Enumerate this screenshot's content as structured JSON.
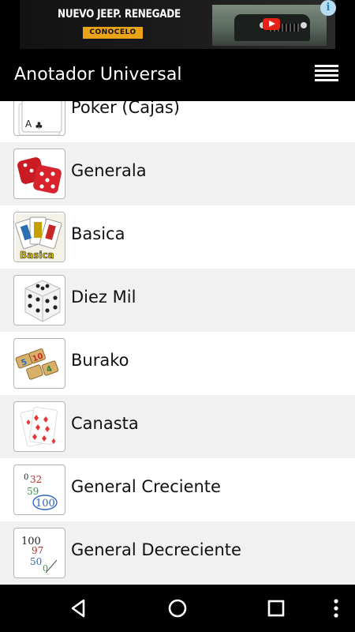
{
  "ad": {
    "headline": "NUEVO JEEP. RENEGADE",
    "cta": "CONOCELO",
    "info_icon": "info-icon"
  },
  "app": {
    "title": "Anotador Universal",
    "menu_icon": "hamburger-menu-icon"
  },
  "games": [
    {
      "label": "Poker (Cajas)",
      "icon": "poker-cards-icon"
    },
    {
      "label": "Generala",
      "icon": "red-dice-icon"
    },
    {
      "label": "Basica",
      "icon": "spanish-cards-icon",
      "icon_text": "Basica"
    },
    {
      "label": "Diez Mil",
      "icon": "white-die-icon"
    },
    {
      "label": "Burako",
      "icon": "domino-tiles-icon",
      "tile_numbers": [
        "5",
        "10",
        "4"
      ]
    },
    {
      "label": "Canasta",
      "icon": "diamond-cards-icon"
    },
    {
      "label": "General Creciente",
      "icon": "increasing-numbers-icon",
      "numbers": [
        "0",
        "32",
        "59",
        "100"
      ]
    },
    {
      "label": "General Decreciente",
      "icon": "decreasing-numbers-icon",
      "numbers": [
        "100",
        "97",
        "50",
        "0"
      ]
    }
  ],
  "navbar": {
    "back": "back-icon",
    "home": "home-icon",
    "recents": "recents-icon",
    "more": "more-vertical-icon"
  },
  "colors": {
    "bar_background": "#000000",
    "row_alt": "#f1f1f1",
    "ad_cta": "#e8a317"
  }
}
